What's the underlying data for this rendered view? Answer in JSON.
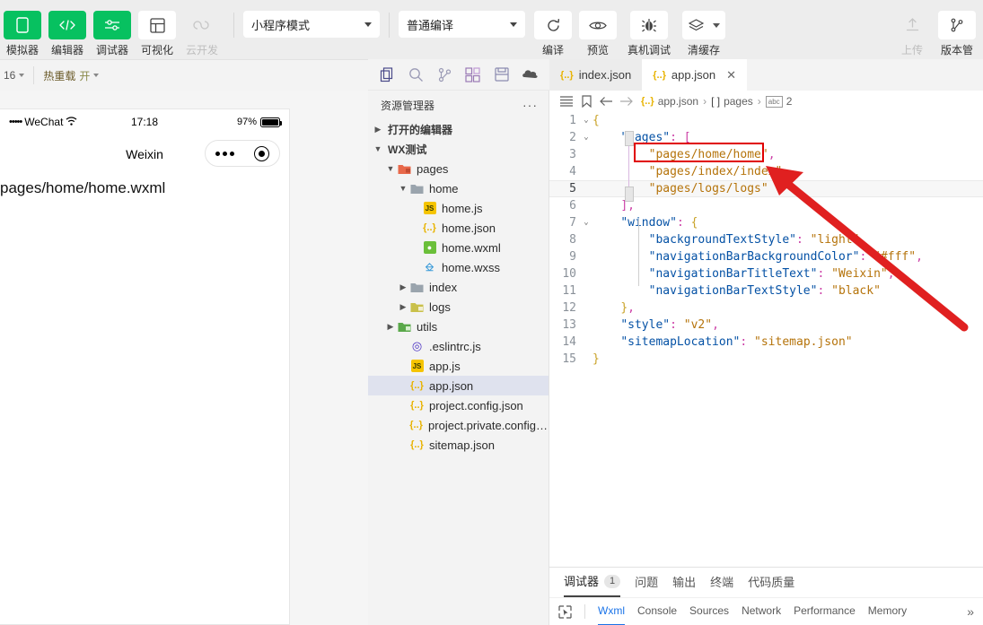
{
  "toolbar": {
    "buttons": [
      {
        "label": "模拟器",
        "icon": "phone-icon",
        "style": "green"
      },
      {
        "label": "编辑器",
        "icon": "code-icon",
        "style": "green"
      },
      {
        "label": "调试器",
        "icon": "sliders-icon",
        "style": "green"
      },
      {
        "label": "可视化",
        "icon": "layout-icon",
        "style": "white"
      },
      {
        "label": "云开发",
        "icon": "cloud-icon",
        "style": "disabled"
      }
    ],
    "mode_select": "小程序模式",
    "compile_select": "普通编译",
    "actions": [
      {
        "label": "编译",
        "icon": "refresh-icon"
      },
      {
        "label": "预览",
        "icon": "eye-icon"
      },
      {
        "label": "真机调试",
        "icon": "bug-icon"
      },
      {
        "label": "清缓存",
        "icon": "layers-icon"
      }
    ],
    "right": [
      {
        "label": "上传",
        "icon": "upload-icon",
        "disabled": true
      },
      {
        "label": "版本管",
        "icon": "branch-icon",
        "disabled": false
      }
    ]
  },
  "subbar": {
    "scale": "16",
    "hotreload_label": "热重载",
    "hotreload_value": "开",
    "icons": [
      "refresh-icon",
      "record-icon",
      "mobile-icon",
      "window-icon"
    ]
  },
  "simulator": {
    "status": {
      "carrier": "WeChat",
      "signal_dots": "•••••",
      "time": "17:18",
      "battery": "97%"
    },
    "nav_title": "Weixin",
    "page_text": "pages/home/home.wxml"
  },
  "explorer": {
    "activity_icons": [
      "files-icon",
      "search-icon",
      "source-control-icon",
      "extensions-icon",
      "save-icon",
      "cloud-debug-icon"
    ],
    "title": "资源管理器",
    "more": "···",
    "sections": [
      {
        "label": "打开的编辑器",
        "expanded": false
      },
      {
        "label": "WX测试",
        "expanded": true
      }
    ],
    "tree": [
      {
        "label": "pages",
        "type": "folder-pages",
        "depth": 1,
        "expanded": true
      },
      {
        "label": "home",
        "type": "folder",
        "depth": 2,
        "expanded": true
      },
      {
        "label": "home.js",
        "type": "js",
        "depth": 3
      },
      {
        "label": "home.json",
        "type": "json",
        "depth": 3
      },
      {
        "label": "home.wxml",
        "type": "wxml",
        "depth": 3
      },
      {
        "label": "home.wxss",
        "type": "wxss",
        "depth": 3
      },
      {
        "label": "index",
        "type": "folder",
        "depth": 2,
        "expanded": false
      },
      {
        "label": "logs",
        "type": "folder-logs",
        "depth": 2,
        "expanded": false
      },
      {
        "label": "utils",
        "type": "folder-utils",
        "depth": 1,
        "expanded": false
      },
      {
        "label": ".eslintrc.js",
        "type": "eslint",
        "depth": 2
      },
      {
        "label": "app.js",
        "type": "js",
        "depth": 2
      },
      {
        "label": "app.json",
        "type": "json",
        "depth": 2,
        "selected": true
      },
      {
        "label": "project.config.json",
        "type": "json",
        "depth": 2
      },
      {
        "label": "project.private.config.js...",
        "type": "json",
        "depth": 2
      },
      {
        "label": "sitemap.json",
        "type": "json",
        "depth": 2
      }
    ]
  },
  "editor": {
    "tabs": [
      {
        "label": "index.json",
        "active": false,
        "closable": false
      },
      {
        "label": "app.json",
        "active": true,
        "closable": true
      }
    ],
    "close_glyph": "✕",
    "breadcrumb": {
      "file": "app.json",
      "sep": "›",
      "array": "[ ]",
      "array_label": "pages",
      "index_label": "2"
    },
    "lines": [
      {
        "n": 1,
        "fold": "⌄",
        "text": "{"
      },
      {
        "n": 2,
        "fold": "⌄",
        "text": "    \"pages\": ["
      },
      {
        "n": 3,
        "fold": "",
        "text": "        \"pages/home/home\","
      },
      {
        "n": 4,
        "fold": "",
        "text": "        \"pages/index/index\","
      },
      {
        "n": 5,
        "fold": "",
        "text": "        \"pages/logs/logs\"",
        "current": true
      },
      {
        "n": 6,
        "fold": "",
        "text": "    ],"
      },
      {
        "n": 7,
        "fold": "⌄",
        "text": "    \"window\": {"
      },
      {
        "n": 8,
        "fold": "",
        "text": "        \"backgroundTextStyle\": \"light\","
      },
      {
        "n": 9,
        "fold": "",
        "text": "        \"navigationBarBackgroundColor\": \"#fff\","
      },
      {
        "n": 10,
        "fold": "",
        "text": "        \"navigationBarTitleText\": \"Weixin\","
      },
      {
        "n": 11,
        "fold": "",
        "text": "        \"navigationBarTextStyle\": \"black\""
      },
      {
        "n": 12,
        "fold": "",
        "text": "    },"
      },
      {
        "n": 13,
        "fold": "",
        "text": "    \"style\": \"v2\","
      },
      {
        "n": 14,
        "fold": "",
        "text": "    \"sitemapLocation\": \"sitemap.json\""
      },
      {
        "n": 15,
        "fold": "",
        "text": "}"
      }
    ],
    "annotation": {
      "highlight_color": "#e00000",
      "arrow_color": "#e02020",
      "highlighted_text": "\"pages/home/home\","
    }
  },
  "bottom": {
    "panel_tabs": [
      {
        "label": "调试器",
        "badge": "1",
        "active": true
      },
      {
        "label": "问题",
        "badge": "",
        "active": false
      },
      {
        "label": "输出",
        "badge": "",
        "active": false
      },
      {
        "label": "终端",
        "badge": "",
        "active": false
      },
      {
        "label": "代码质量",
        "badge": "",
        "active": false
      }
    ],
    "devtools_tabs": [
      {
        "label": "Wxml",
        "active": true
      },
      {
        "label": "Console",
        "active": false
      },
      {
        "label": "Sources",
        "active": false
      },
      {
        "label": "Network",
        "active": false
      },
      {
        "label": "Performance",
        "active": false
      },
      {
        "label": "Memory",
        "active": false
      }
    ],
    "overflow_glyph": "»",
    "inspect_icon": "inspect-icon"
  },
  "colors": {
    "brand_green": "#07c160",
    "toolbar_bg": "#ededed",
    "sidebar_bg": "#f3f3f3",
    "selected_row": "#dfe2ee",
    "devtools_accent": "#1a73e8"
  }
}
